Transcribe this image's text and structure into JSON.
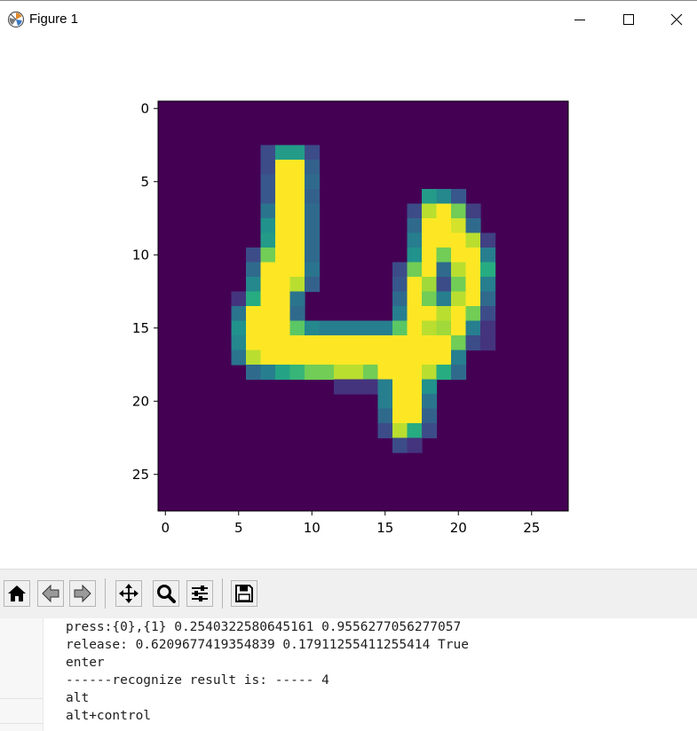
{
  "window": {
    "title": "Figure 1",
    "minimize_icon": "minimize-icon",
    "maximize_icon": "maximize-icon",
    "close_icon": "close-icon"
  },
  "figure": {
    "chart_data": {
      "type": "heatmap",
      "colormap": "viridis",
      "rows": 28,
      "cols": 28,
      "x_ticks": [
        "0",
        "5",
        "10",
        "15",
        "20",
        "25"
      ],
      "y_ticks": [
        "0",
        "5",
        "10",
        "15",
        "20",
        "25"
      ],
      "xlim": [
        -0.5,
        27.5
      ],
      "ylim": [
        27.5,
        -0.5
      ],
      "title": "",
      "xlabel": "",
      "ylabel": "",
      "value_range": [
        0,
        255
      ],
      "nonzero_pixels": [
        [
          3,
          7,
          60
        ],
        [
          3,
          8,
          140
        ],
        [
          3,
          9,
          140
        ],
        [
          3,
          10,
          60
        ],
        [
          4,
          7,
          60
        ],
        [
          4,
          8,
          255
        ],
        [
          4,
          9,
          255
        ],
        [
          4,
          10,
          80
        ],
        [
          5,
          7,
          70
        ],
        [
          5,
          8,
          255
        ],
        [
          5,
          9,
          255
        ],
        [
          5,
          10,
          90
        ],
        [
          6,
          7,
          70
        ],
        [
          6,
          8,
          255
        ],
        [
          6,
          9,
          255
        ],
        [
          6,
          10,
          80
        ],
        [
          6,
          18,
          140
        ],
        [
          6,
          19,
          120
        ],
        [
          6,
          20,
          70
        ],
        [
          7,
          7,
          100
        ],
        [
          7,
          8,
          255
        ],
        [
          7,
          9,
          255
        ],
        [
          7,
          10,
          90
        ],
        [
          7,
          17,
          60
        ],
        [
          7,
          18,
          230
        ],
        [
          7,
          19,
          255
        ],
        [
          7,
          20,
          200
        ],
        [
          7,
          21,
          50
        ],
        [
          8,
          7,
          130
        ],
        [
          8,
          8,
          255
        ],
        [
          8,
          9,
          255
        ],
        [
          8,
          10,
          90
        ],
        [
          8,
          17,
          90
        ],
        [
          8,
          18,
          255
        ],
        [
          8,
          19,
          255
        ],
        [
          8,
          20,
          240
        ],
        [
          8,
          21,
          90
        ],
        [
          9,
          7,
          140
        ],
        [
          9,
          8,
          255
        ],
        [
          9,
          9,
          255
        ],
        [
          9,
          10,
          90
        ],
        [
          9,
          17,
          110
        ],
        [
          9,
          18,
          255
        ],
        [
          9,
          19,
          255
        ],
        [
          9,
          20,
          255
        ],
        [
          9,
          21,
          230
        ],
        [
          9,
          22,
          50
        ],
        [
          10,
          6,
          60
        ],
        [
          10,
          7,
          200
        ],
        [
          10,
          8,
          255
        ],
        [
          10,
          9,
          255
        ],
        [
          10,
          10,
          90
        ],
        [
          10,
          17,
          130
        ],
        [
          10,
          18,
          255
        ],
        [
          10,
          19,
          200
        ],
        [
          10,
          20,
          255
        ],
        [
          10,
          21,
          255
        ],
        [
          10,
          22,
          110
        ],
        [
          11,
          6,
          90
        ],
        [
          11,
          7,
          255
        ],
        [
          11,
          8,
          255
        ],
        [
          11,
          9,
          255
        ],
        [
          11,
          10,
          100
        ],
        [
          11,
          16,
          60
        ],
        [
          11,
          17,
          200
        ],
        [
          11,
          18,
          255
        ],
        [
          11,
          19,
          90
        ],
        [
          11,
          20,
          230
        ],
        [
          11,
          21,
          255
        ],
        [
          11,
          22,
          160
        ],
        [
          12,
          6,
          120
        ],
        [
          12,
          7,
          255
        ],
        [
          12,
          8,
          255
        ],
        [
          12,
          9,
          230
        ],
        [
          12,
          10,
          80
        ],
        [
          12,
          16,
          70
        ],
        [
          12,
          17,
          255
        ],
        [
          12,
          18,
          220
        ],
        [
          12,
          19,
          60
        ],
        [
          12,
          20,
          200
        ],
        [
          12,
          21,
          255
        ],
        [
          12,
          22,
          110
        ],
        [
          13,
          5,
          40
        ],
        [
          13,
          6,
          160
        ],
        [
          13,
          7,
          255
        ],
        [
          13,
          8,
          255
        ],
        [
          13,
          9,
          100
        ],
        [
          13,
          16,
          90
        ],
        [
          13,
          17,
          255
        ],
        [
          13,
          18,
          200
        ],
        [
          13,
          19,
          110
        ],
        [
          13,
          20,
          230
        ],
        [
          13,
          21,
          255
        ],
        [
          13,
          22,
          90
        ],
        [
          14,
          5,
          100
        ],
        [
          14,
          6,
          255
        ],
        [
          14,
          7,
          255
        ],
        [
          14,
          8,
          255
        ],
        [
          14,
          9,
          90
        ],
        [
          14,
          16,
          110
        ],
        [
          14,
          17,
          255
        ],
        [
          14,
          18,
          255
        ],
        [
          14,
          19,
          230
        ],
        [
          14,
          20,
          255
        ],
        [
          14,
          21,
          200
        ],
        [
          14,
          22,
          60
        ],
        [
          15,
          5,
          130
        ],
        [
          15,
          6,
          255
        ],
        [
          15,
          7,
          255
        ],
        [
          15,
          8,
          255
        ],
        [
          15,
          9,
          190
        ],
        [
          15,
          10,
          120
        ],
        [
          15,
          11,
          110
        ],
        [
          15,
          12,
          110
        ],
        [
          15,
          13,
          110
        ],
        [
          15,
          14,
          110
        ],
        [
          15,
          15,
          110
        ],
        [
          15,
          16,
          190
        ],
        [
          15,
          17,
          255
        ],
        [
          15,
          18,
          230
        ],
        [
          15,
          19,
          220
        ],
        [
          15,
          20,
          255
        ],
        [
          15,
          21,
          110
        ],
        [
          15,
          22,
          40
        ],
        [
          16,
          5,
          120
        ],
        [
          16,
          6,
          255
        ],
        [
          16,
          7,
          255
        ],
        [
          16,
          8,
          255
        ],
        [
          16,
          9,
          255
        ],
        [
          16,
          10,
          255
        ],
        [
          16,
          11,
          255
        ],
        [
          16,
          12,
          255
        ],
        [
          16,
          13,
          255
        ],
        [
          16,
          14,
          255
        ],
        [
          16,
          15,
          255
        ],
        [
          16,
          16,
          255
        ],
        [
          16,
          17,
          255
        ],
        [
          16,
          18,
          255
        ],
        [
          16,
          19,
          255
        ],
        [
          16,
          20,
          200
        ],
        [
          16,
          21,
          60
        ],
        [
          16,
          22,
          40
        ],
        [
          17,
          5,
          100
        ],
        [
          17,
          6,
          230
        ],
        [
          17,
          7,
          255
        ],
        [
          17,
          8,
          255
        ],
        [
          17,
          9,
          255
        ],
        [
          17,
          10,
          255
        ],
        [
          17,
          11,
          255
        ],
        [
          17,
          12,
          255
        ],
        [
          17,
          13,
          255
        ],
        [
          17,
          14,
          255
        ],
        [
          17,
          15,
          255
        ],
        [
          17,
          16,
          255
        ],
        [
          17,
          17,
          255
        ],
        [
          17,
          18,
          255
        ],
        [
          17,
          19,
          255
        ],
        [
          17,
          20,
          110
        ],
        [
          18,
          6,
          90
        ],
        [
          18,
          7,
          110
        ],
        [
          18,
          8,
          150
        ],
        [
          18,
          9,
          170
        ],
        [
          18,
          10,
          200
        ],
        [
          18,
          11,
          200
        ],
        [
          18,
          12,
          230
        ],
        [
          18,
          13,
          230
        ],
        [
          18,
          14,
          200
        ],
        [
          18,
          15,
          255
        ],
        [
          18,
          16,
          255
        ],
        [
          18,
          17,
          255
        ],
        [
          18,
          18,
          230
        ],
        [
          18,
          19,
          160
        ],
        [
          18,
          20,
          90
        ],
        [
          19,
          12,
          40
        ],
        [
          19,
          13,
          40
        ],
        [
          19,
          14,
          40
        ],
        [
          19,
          15,
          110
        ],
        [
          19,
          16,
          255
        ],
        [
          19,
          17,
          255
        ],
        [
          19,
          18,
          130
        ],
        [
          20,
          15,
          110
        ],
        [
          20,
          16,
          255
        ],
        [
          20,
          17,
          255
        ],
        [
          20,
          18,
          100
        ],
        [
          21,
          15,
          90
        ],
        [
          21,
          16,
          255
        ],
        [
          21,
          17,
          255
        ],
        [
          21,
          18,
          80
        ],
        [
          22,
          15,
          60
        ],
        [
          22,
          16,
          230
        ],
        [
          22,
          17,
          160
        ],
        [
          22,
          18,
          60
        ],
        [
          23,
          16,
          60
        ],
        [
          23,
          17,
          40
        ]
      ]
    }
  },
  "toolbar": {
    "buttons": [
      {
        "icon": "home-icon"
      },
      {
        "icon": "back-arrow-icon"
      },
      {
        "icon": "forward-arrow-icon"
      },
      {
        "icon": "pan-icon"
      },
      {
        "icon": "zoom-icon"
      },
      {
        "icon": "configure-subplots-icon"
      },
      {
        "icon": "save-icon"
      }
    ]
  },
  "console": {
    "lines": [
      "press:{0},{1} 0.2540322580645161 0.9556277056277057",
      "release: 0.6209677419354839 0.17911255411255414 True",
      "enter",
      "------recognize result is: ----- 4",
      "alt",
      "alt+control"
    ]
  }
}
